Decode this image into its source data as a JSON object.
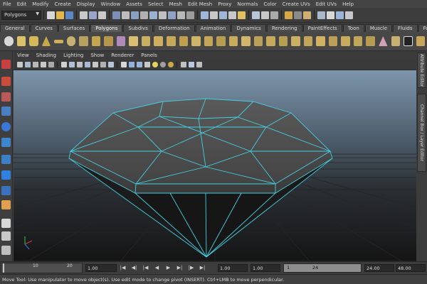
{
  "menubar": {
    "items": [
      "File",
      "Edit",
      "Modify",
      "Create",
      "Display",
      "Window",
      "Assets",
      "Select",
      "Mesh",
      "Edit Mesh",
      "Proxy",
      "Normals",
      "Color",
      "Create UVs",
      "Edit UVs",
      "Help"
    ]
  },
  "toolbar": {
    "mode": "Polygons"
  },
  "shelf": {
    "tabs": [
      "General",
      "Curves",
      "Surfaces",
      "Polygons",
      "Subdivs",
      "Deformation",
      "Animation",
      "Dynamics",
      "Rendering",
      "PaintEffects",
      "Toon",
      "Muscle",
      "Fluids",
      "Fur"
    ],
    "active_tab": "Polygons"
  },
  "panel": {
    "menus": [
      "View",
      "Shading",
      "Lighting",
      "Show",
      "Renderer",
      "Panels"
    ]
  },
  "side_tabs": {
    "attribute_editor": "Attribute Editor",
    "channel_box": "Channel Box / Layer Editor"
  },
  "timeline": {
    "ticks": [
      "10",
      "20"
    ],
    "current_time": "1.00",
    "start_time": "1.00",
    "range_start_field": "1.00",
    "range_min": "1",
    "range_max": "24",
    "end_time": "24.00",
    "anim_end": "48.00"
  },
  "helpline": {
    "text": "Move Tool: Use manipulator to move object(s). Use edit mode to change pivot (INSERT). Ctrl+LMB to move perpendicular."
  },
  "colors": {
    "wireframe": "#46cde0",
    "viewport_top": "#7d95ab",
    "viewport_bottom": "#141414",
    "grid": "#2a2a2a"
  }
}
